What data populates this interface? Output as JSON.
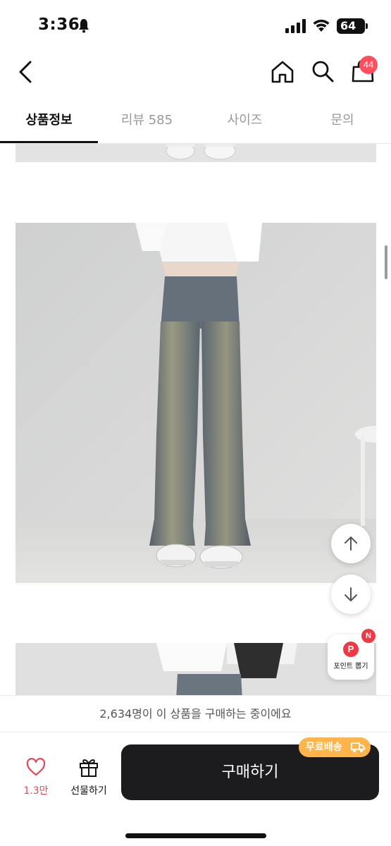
{
  "status_bar": {
    "time": "3:36",
    "battery": "64"
  },
  "header": {
    "cart_count": "44"
  },
  "tabs": [
    {
      "label": "상품정보",
      "active": true
    },
    {
      "label": "리뷰 585",
      "active": false
    },
    {
      "label": "사이즈",
      "active": false
    },
    {
      "label": "문의",
      "active": false
    }
  ],
  "floating": {
    "points_badge": "N",
    "points_icon_letter": "P",
    "points_label": "포인트 뽑기"
  },
  "bottom_bar": {
    "buyers_text": "2,634명이 이 상품을 구매하는 중이에요",
    "like_count": "1.3만",
    "gift_label": "선물하기",
    "buy_label": "구매하기",
    "free_shipping": "무료배송"
  },
  "colors": {
    "accent_red": "#ef3a45",
    "like_pink": "#e9475a",
    "free_ship_orange": "#ffb54a",
    "buy_button": "#1c1c1e"
  }
}
